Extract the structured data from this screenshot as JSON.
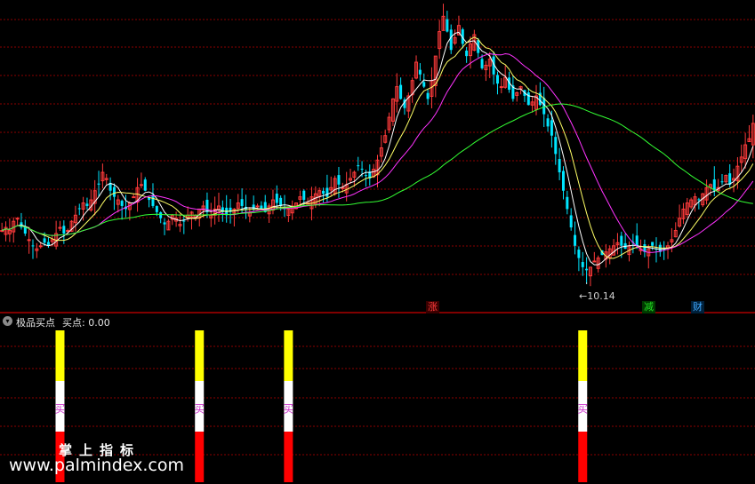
{
  "chart_data": [
    {
      "type": "candlestick",
      "title": "",
      "low_annotation": "10.14",
      "event_tags": [
        {
          "text": "涨",
          "color": "#ff3b3b",
          "bar_index": 116
        },
        {
          "text": "减",
          "color": "#22e022",
          "bar_index": 175
        },
        {
          "text": "财",
          "color": "#3fa9ff",
          "bar_index": 188
        }
      ],
      "close_path": [
        11.5,
        11.6,
        11.5,
        11.8,
        11.9,
        11.6,
        11.4,
        11.2,
        11.0,
        10.9,
        11.0,
        11.1,
        11.0,
        11.2,
        11.4,
        11.6,
        11.4,
        11.5,
        11.8,
        12.0,
        12.2,
        12.4,
        12.3,
        12.5,
        12.8,
        13.0,
        13.4,
        13.2,
        12.8,
        12.6,
        12.5,
        12.3,
        12.2,
        12.4,
        12.6,
        12.9,
        13.0,
        12.8,
        12.5,
        12.3,
        12.1,
        11.9,
        11.7,
        11.8,
        12.0,
        11.9,
        11.7,
        11.8,
        12.0,
        12.1,
        12.0,
        12.2,
        12.3,
        12.1,
        12.0,
        12.2,
        12.3,
        12.1,
        12.0,
        12.1,
        12.2,
        12.4,
        12.3,
        12.2,
        12.1,
        12.2,
        12.3,
        12.2,
        12.1,
        12.3,
        12.5,
        12.4,
        12.3,
        12.2,
        12.2,
        12.3,
        12.4,
        12.6,
        12.5,
        12.4,
        12.6,
        12.7,
        12.8,
        12.7,
        12.6,
        12.9,
        13.2,
        13.0,
        12.9,
        13.0,
        13.2,
        13.4,
        13.6,
        13.5,
        13.3,
        13.2,
        13.5,
        13.8,
        14.2,
        14.6,
        15.2,
        15.8,
        16.2,
        15.8,
        15.5,
        15.9,
        16.4,
        17.0,
        16.6,
        16.2,
        15.8,
        16.4,
        17.2,
        18.0,
        18.5,
        18.0,
        17.4,
        17.8,
        18.2,
        17.6,
        17.2,
        17.6,
        17.9,
        17.3,
        16.8,
        16.9,
        17.1,
        16.6,
        16.3,
        16.2,
        16.5,
        16.1,
        15.8,
        16.0,
        16.2,
        15.9,
        15.6,
        15.7,
        15.9,
        15.6,
        15.3,
        14.9,
        14.6,
        14.0,
        13.4,
        12.8,
        12.2,
        11.6,
        11.0,
        10.6,
        10.3,
        10.2,
        10.3,
        10.5,
        10.6,
        10.7,
        10.8,
        10.9,
        11.0,
        11.1,
        11.0,
        10.9,
        11.0,
        11.1,
        11.0,
        10.9,
        10.8,
        10.9,
        11.0,
        10.9,
        10.8,
        10.9,
        11.0,
        11.2,
        11.5,
        11.9,
        12.2,
        12.4,
        12.5,
        12.6,
        12.5,
        12.7,
        12.9,
        13.0,
        12.8,
        12.9,
        13.1,
        13.3,
        13.0,
        13.2,
        13.6,
        13.9,
        14.3,
        14.5,
        15.0
      ],
      "price_range": [
        9.6,
        18.8
      ]
    },
    {
      "type": "bar",
      "indicator_name": "极品买点",
      "series_label": "买点:",
      "current_value": "0.00",
      "signal_bars": [
        {
          "bar_index": 15,
          "label": "买"
        },
        {
          "bar_index": 51,
          "label": "买"
        },
        {
          "bar_index": 74,
          "label": "买"
        },
        {
          "bar_index": 150,
          "label": "买"
        }
      ],
      "segment_colors": {
        "top": "#ffff00",
        "middle": "#ffffff",
        "bottom": "#ff0000"
      },
      "label_color": "#cc33cc"
    }
  ],
  "ui": {
    "indicator_title": "极品买点",
    "indicator_value": "买点: 0.00",
    "brand_cn": "掌上指标",
    "brand_url": "www.palmindex.com",
    "tag_zhang": "涨",
    "tag_jian": "减",
    "tag_cai": "财",
    "low_label": "←10.14"
  },
  "colors": {
    "background": "#000000",
    "grid": "#8b0000",
    "up_candle": "#ff3b3b",
    "down_candle": "#00e5ff",
    "ma_short": "#ffffff",
    "ma_mid": "#ffff66",
    "ma_long": "#ff33ff",
    "ma_longest": "#33ff33",
    "divider": "#ff0000"
  }
}
